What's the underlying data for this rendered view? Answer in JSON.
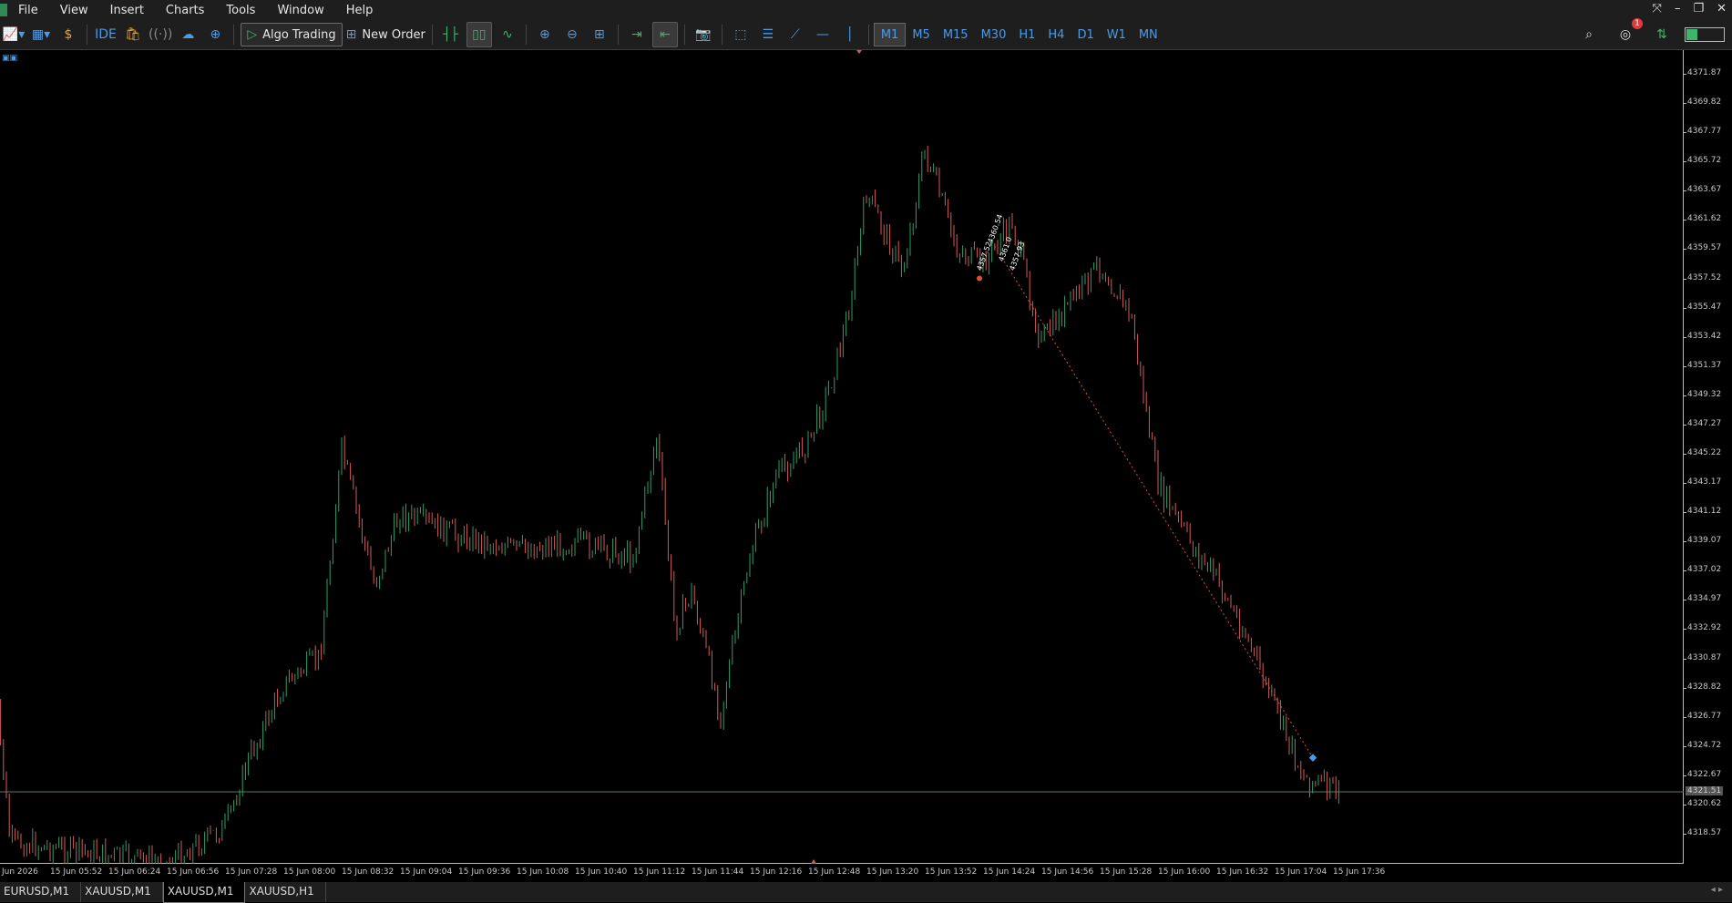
{
  "menu": [
    "File",
    "View",
    "Insert",
    "Charts",
    "Tools",
    "Window",
    "Help"
  ],
  "toolbar": {
    "ide_label": "IDE",
    "algo_label": "Algo Trading",
    "new_order_label": "New Order",
    "timeframes": [
      "M1",
      "M5",
      "M15",
      "M30",
      "H1",
      "H4",
      "D1",
      "W1",
      "MN"
    ],
    "active_timeframe": "M1",
    "notification_count": "1"
  },
  "price_axis": [
    "4371.87",
    "4369.82",
    "4367.77",
    "4365.72",
    "4363.67",
    "4361.62",
    "4359.57",
    "4357.52",
    "4355.47",
    "4353.42",
    "4351.37",
    "4349.32",
    "4347.27",
    "4345.22",
    "4343.17",
    "4341.12",
    "4339.07",
    "4337.02",
    "4334.97",
    "4332.92",
    "4330.87",
    "4328.82",
    "4326.77",
    "4324.72",
    "4322.67",
    "4320.62",
    "4318.57"
  ],
  "current_price": "4321.51",
  "time_axis": [
    "Jun 2026",
    "15 Jun 05:52",
    "15 Jun 06:24",
    "15 Jun 06:56",
    "15 Jun 07:28",
    "15 Jun 08:00",
    "15 Jun 08:32",
    "15 Jun 09:04",
    "15 Jun 09:36",
    "15 Jun 10:08",
    "15 Jun 10:40",
    "15 Jun 11:12",
    "15 Jun 11:44",
    "15 Jun 12:16",
    "15 Jun 12:48",
    "15 Jun 13:20",
    "15 Jun 13:52",
    "15 Jun 14:24",
    "15 Jun 14:56",
    "15 Jun 15:28",
    "15 Jun 16:00",
    "15 Jun 16:32",
    "15 Jun 17:04",
    "15 Jun 17:36"
  ],
  "trade_labels": [
    "4357.52",
    "4360.54",
    "4361.0",
    "4357.93"
  ],
  "tabs": [
    "EURUSD,M1",
    "XAUUSD,M1",
    "XAUUSD,M1",
    "XAUUSD,H1"
  ],
  "active_tab_index": 2,
  "colors": {
    "bull": "#2e9e6a",
    "bear": "#d65a5a",
    "trade_line": "#e0502a"
  },
  "chart_data": {
    "type": "candlestick",
    "symbol_tabs": "XAUUSD,M1",
    "ylim": [
      4317.5,
      4372.9
    ],
    "close_path": [
      [
        "15 Jun 05:20",
        4331.5
      ],
      [
        "15 Jun 05:30",
        4318.0
      ],
      [
        "15 Jun 06:56",
        4316.5
      ],
      [
        "15 Jun 07:28",
        4319.0
      ],
      [
        "15 Jun 07:40",
        4323.5
      ],
      [
        "15 Jun 08:00",
        4329.0
      ],
      [
        "15 Jun 08:20",
        4331.0
      ],
      [
        "15 Jun 08:32",
        4345.5
      ],
      [
        "15 Jun 08:50",
        4336.0
      ],
      [
        "15 Jun 09:04",
        4341.0
      ],
      [
        "15 Jun 09:36",
        4339.5
      ],
      [
        "15 Jun 10:08",
        4338.5
      ],
      [
        "15 Jun 10:40",
        4339.0
      ],
      [
        "15 Jun 11:12",
        4338.0
      ],
      [
        "15 Jun 11:25",
        4346.5
      ],
      [
        "15 Jun 11:35",
        4333.0
      ],
      [
        "15 Jun 11:44",
        4335.5
      ],
      [
        "15 Jun 12:00",
        4327.0
      ],
      [
        "15 Jun 12:16",
        4338.0
      ],
      [
        "15 Jun 12:30",
        4343.5
      ],
      [
        "15 Jun 12:48",
        4346.0
      ],
      [
        "15 Jun 13:00",
        4350.0
      ],
      [
        "15 Jun 13:10",
        4355.0
      ],
      [
        "15 Jun 13:20",
        4363.5
      ],
      [
        "15 Jun 13:40",
        4358.0
      ],
      [
        "15 Jun 13:52",
        4366.5
      ],
      [
        "15 Jun 14:10",
        4359.5
      ],
      [
        "15 Jun 14:24",
        4358.5
      ],
      [
        "15 Jun 14:40",
        4361.5
      ],
      [
        "15 Jun 14:56",
        4353.0
      ],
      [
        "15 Jun 15:10",
        4355.5
      ],
      [
        "15 Jun 15:28",
        4358.5
      ],
      [
        "15 Jun 15:45",
        4355.0
      ],
      [
        "15 Jun 16:00",
        4343.0
      ],
      [
        "15 Jun 16:20",
        4338.5
      ],
      [
        "15 Jun 16:32",
        4336.5
      ],
      [
        "15 Jun 16:50",
        4332.0
      ],
      [
        "15 Jun 17:04",
        4327.5
      ],
      [
        "15 Jun 17:20",
        4322.5
      ],
      [
        "15 Jun 17:40",
        4321.5
      ]
    ]
  }
}
